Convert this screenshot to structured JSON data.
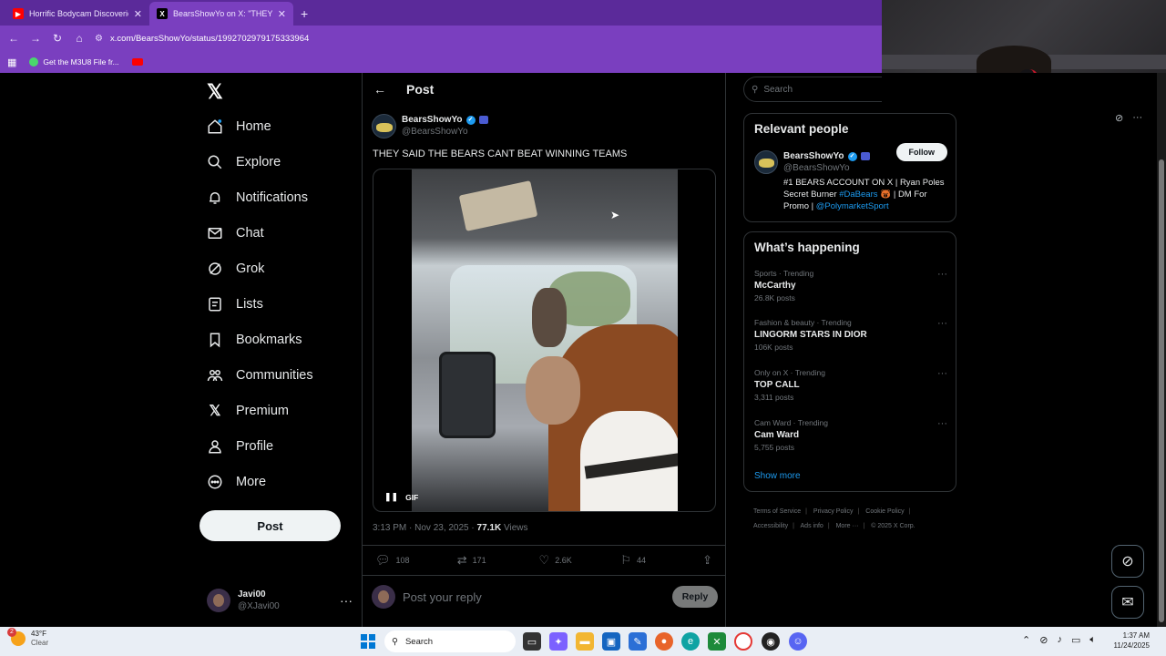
{
  "browser": {
    "tabs": [
      {
        "title": "Horrific Bodycam Discoveries E",
        "icon": "youtube-icon"
      },
      {
        "title": "BearsShowYo on X: \"THEY SAID",
        "icon": "x-icon"
      }
    ],
    "url": "x.com/BearsShowYo/status/1992702979175333964",
    "bookmarks": [
      {
        "label": "Get the M3U8 File fr..."
      }
    ]
  },
  "sidebar": {
    "items": [
      {
        "label": "Home",
        "icon": "home-icon"
      },
      {
        "label": "Explore",
        "icon": "search-icon"
      },
      {
        "label": "Notifications",
        "icon": "bell-icon"
      },
      {
        "label": "Chat",
        "icon": "mail-icon"
      },
      {
        "label": "Grok",
        "icon": "grok-icon"
      },
      {
        "label": "Lists",
        "icon": "list-icon"
      },
      {
        "label": "Bookmarks",
        "icon": "bookmark-icon"
      },
      {
        "label": "Communities",
        "icon": "people-icon"
      },
      {
        "label": "Premium",
        "icon": "x-icon"
      },
      {
        "label": "Profile",
        "icon": "person-icon"
      },
      {
        "label": "More",
        "icon": "more-circle-icon"
      }
    ],
    "post_label": "Post",
    "account": {
      "name": "Javi00",
      "handle": "@XJavi00"
    }
  },
  "post": {
    "header_title": "Post",
    "author_name": "BearsShowYo",
    "author_handle": "@BearsShowYo",
    "text": "THEY SAID THE BEARS CANT BEAT WINNING TEAMS",
    "media_label": "GIF",
    "timestamp": "3:13 PM · Nov 23, 2025 · ",
    "views_count": "77.1K",
    "views_label": " Views",
    "stats": {
      "replies": "108",
      "reposts": "171",
      "likes": "2.6K",
      "bookmarks": "44"
    },
    "reply_placeholder": "Post your reply",
    "reply_button": "Reply"
  },
  "right": {
    "search_placeholder": "Search",
    "relevant_title": "Relevant people",
    "person": {
      "name": "BearsShowYo",
      "handle": "@BearsShowYo",
      "follow_label": "Follow",
      "bio_1": "#1 BEARS ACCOUNT ON X | Ryan Poles Secret Burner ",
      "bio_tag": "#DaBears",
      "bio_2": " | DM For Promo | ",
      "bio_mention": "@PolymarketSport"
    },
    "happening_title": "What’s happening",
    "trends": [
      {
        "category": "Sports · Trending",
        "name": "McCarthy",
        "count": "26.8K posts"
      },
      {
        "category": "Fashion & beauty · Trending",
        "name": "LINGORM STARS IN DIOR",
        "count": "106K posts"
      },
      {
        "category": "Only on X · Trending",
        "name": "TOP CALL",
        "count": "3,311 posts"
      },
      {
        "category": "Cam Ward · Trending",
        "name": "Cam Ward",
        "count": "5,755 posts"
      }
    ],
    "show_more": "Show more",
    "footer": [
      "Terms of Service",
      "Privacy Policy",
      "Cookie Policy",
      "Accessibility",
      "Ads info",
      "More ···",
      "© 2025 X Corp."
    ]
  },
  "taskbar": {
    "weather_temp": "43°F",
    "weather_desc": "Clear",
    "weather_badge": "2",
    "search_label": "Search",
    "time": "1:37 AM",
    "date": "11/24/2025"
  }
}
